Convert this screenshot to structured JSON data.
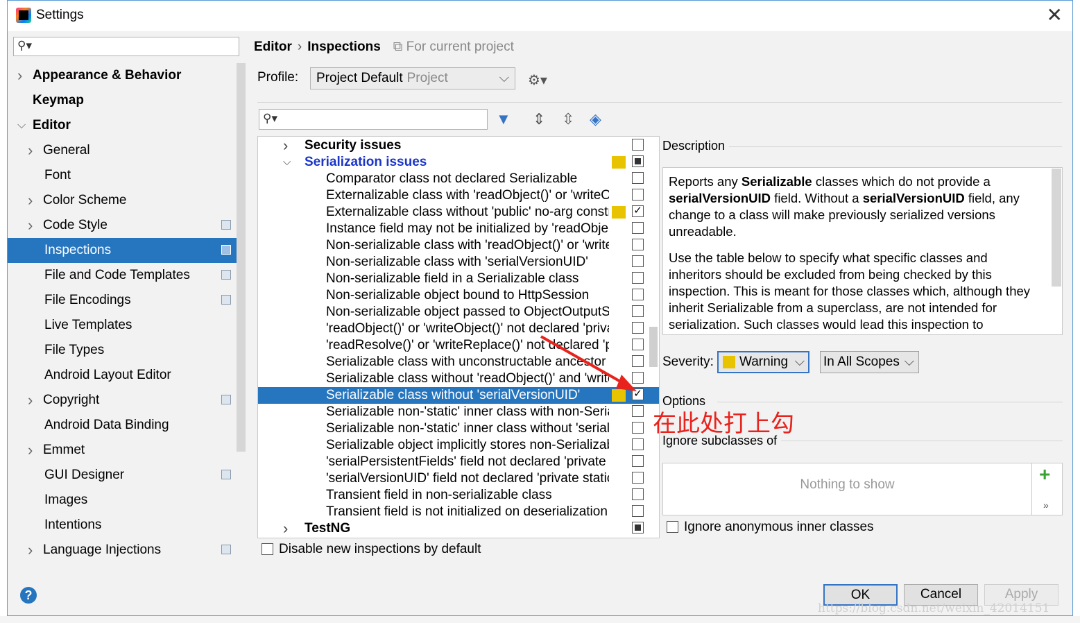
{
  "window": {
    "title": "Settings"
  },
  "breadcrumb": {
    "section": "Editor",
    "page": "Inspections",
    "scope_hint": "For current project"
  },
  "profile": {
    "label": "Profile:",
    "value": "Project Default",
    "suffix": "Project"
  },
  "sidebar": {
    "items": [
      {
        "label": "Appearance & Behavior",
        "bold": true,
        "arrow": "right"
      },
      {
        "label": "Keymap",
        "bold": true,
        "arrow": ""
      },
      {
        "label": "Editor",
        "bold": true,
        "arrow": "down"
      },
      {
        "label": "General",
        "bold": false,
        "arrow": "right"
      },
      {
        "label": "Font",
        "bold": false,
        "arrow": ""
      },
      {
        "label": "Color Scheme",
        "bold": false,
        "arrow": "right"
      },
      {
        "label": "Code Style",
        "bold": false,
        "arrow": "right",
        "copy": true
      },
      {
        "label": "Inspections",
        "bold": false,
        "arrow": "",
        "copy": true,
        "selected": true
      },
      {
        "label": "File and Code Templates",
        "bold": false,
        "arrow": "",
        "copy": true
      },
      {
        "label": "File Encodings",
        "bold": false,
        "arrow": "",
        "copy": true
      },
      {
        "label": "Live Templates",
        "bold": false,
        "arrow": ""
      },
      {
        "label": "File Types",
        "bold": false,
        "arrow": ""
      },
      {
        "label": "Android Layout Editor",
        "bold": false,
        "arrow": ""
      },
      {
        "label": "Copyright",
        "bold": false,
        "arrow": "right",
        "copy": true
      },
      {
        "label": "Android Data Binding",
        "bold": false,
        "arrow": ""
      },
      {
        "label": "Emmet",
        "bold": false,
        "arrow": "right"
      },
      {
        "label": "GUI Designer",
        "bold": false,
        "arrow": "",
        "copy": true
      },
      {
        "label": "Images",
        "bold": false,
        "arrow": ""
      },
      {
        "label": "Intentions",
        "bold": false,
        "arrow": ""
      },
      {
        "label": "Language Injections",
        "bold": false,
        "arrow": "right",
        "copy": true
      }
    ]
  },
  "inspections": {
    "rows": [
      {
        "label": "Security issues",
        "group": true,
        "arrow": "right",
        "check": "none"
      },
      {
        "label": "Serialization issues",
        "group": true,
        "arrow": "down",
        "check": "mixed",
        "severity": true,
        "blue": true
      },
      {
        "label": "Comparator class not declared Serializable",
        "check": "none"
      },
      {
        "label": "Externalizable class with 'readObject()' or 'writeObject()'",
        "check": "none"
      },
      {
        "label": "Externalizable class without 'public' no-arg constructor",
        "check": "checked",
        "severity": true
      },
      {
        "label": "Instance field may not be initialized by 'readObject()'",
        "check": "none"
      },
      {
        "label": "Non-serializable class with 'readObject()' or 'writeObject()'",
        "check": "none"
      },
      {
        "label": "Non-serializable class with 'serialVersionUID'",
        "check": "none"
      },
      {
        "label": "Non-serializable field in a Serializable class",
        "check": "none"
      },
      {
        "label": "Non-serializable object bound to HttpSession",
        "check": "none"
      },
      {
        "label": "Non-serializable object passed to ObjectOutputStream",
        "check": "none"
      },
      {
        "label": "'readObject()' or 'writeObject()' not declared 'private'",
        "check": "none"
      },
      {
        "label": "'readResolve()' or 'writeReplace()' not declared 'protected'",
        "check": "none"
      },
      {
        "label": "Serializable class with unconstructable ancestor",
        "check": "none"
      },
      {
        "label": "Serializable class without 'readObject()' and 'writeObject()'",
        "check": "none"
      },
      {
        "label": "Serializable class without 'serialVersionUID'",
        "check": "checked",
        "severity": true,
        "selected": true
      },
      {
        "label": "Serializable non-'static' inner class with non-Serializable outer class",
        "check": "none"
      },
      {
        "label": "Serializable non-'static' inner class without 'serialVersionUID'",
        "check": "none"
      },
      {
        "label": "Serializable object implicitly stores non-Serializable object",
        "check": "none"
      },
      {
        "label": "'serialPersistentFields' field not declared 'private static final'",
        "check": "none"
      },
      {
        "label": "'serialVersionUID' field not declared 'private static final long'",
        "check": "none"
      },
      {
        "label": "Transient field in non-serializable class",
        "check": "none"
      },
      {
        "label": "Transient field is not initialized on deserialization",
        "check": "none"
      },
      {
        "label": "TestNG",
        "group": true,
        "arrow": "right",
        "check": "mixed"
      }
    ],
    "disable_new_label": "Disable new inspections by default"
  },
  "description": {
    "label": "Description",
    "p1_a": "Reports any ",
    "p1_b": "Serializable",
    "p1_c": " classes which do not provide a ",
    "p1_d": "serialVersionUID",
    "p1_e": " field. Without a ",
    "p1_f": "serialVersionUID",
    "p1_g": " field, any change to a class will make previously serialized versions unreadable.",
    "p2": "Use the table below to specify what specific classes and inheritors should be excluded from being checked by this inspection. This is meant for those classes which, although they inherit Serializable from a superclass, are not intended for serialization. Such classes would lead this inspection to"
  },
  "severity": {
    "label": "Severity:",
    "value": "Warning",
    "color": "#e8c400",
    "scope": "In All Scopes"
  },
  "options": {
    "label": "Options",
    "annotation": "在此处打上勾",
    "ignore_subclasses_label": "Ignore subclasses of",
    "empty_text": "Nothing to show",
    "ignore_anonymous_label": "Ignore anonymous inner classes"
  },
  "buttons": {
    "ok": "OK",
    "cancel": "Cancel",
    "apply": "Apply",
    "help": "?"
  },
  "watermark": "https://blog.csdn.net/weixin_42014151",
  "colors": {
    "selection": "#2675bf",
    "accent": "#3574c4",
    "annotation": "#e8231d",
    "warning": "#e8c400"
  }
}
